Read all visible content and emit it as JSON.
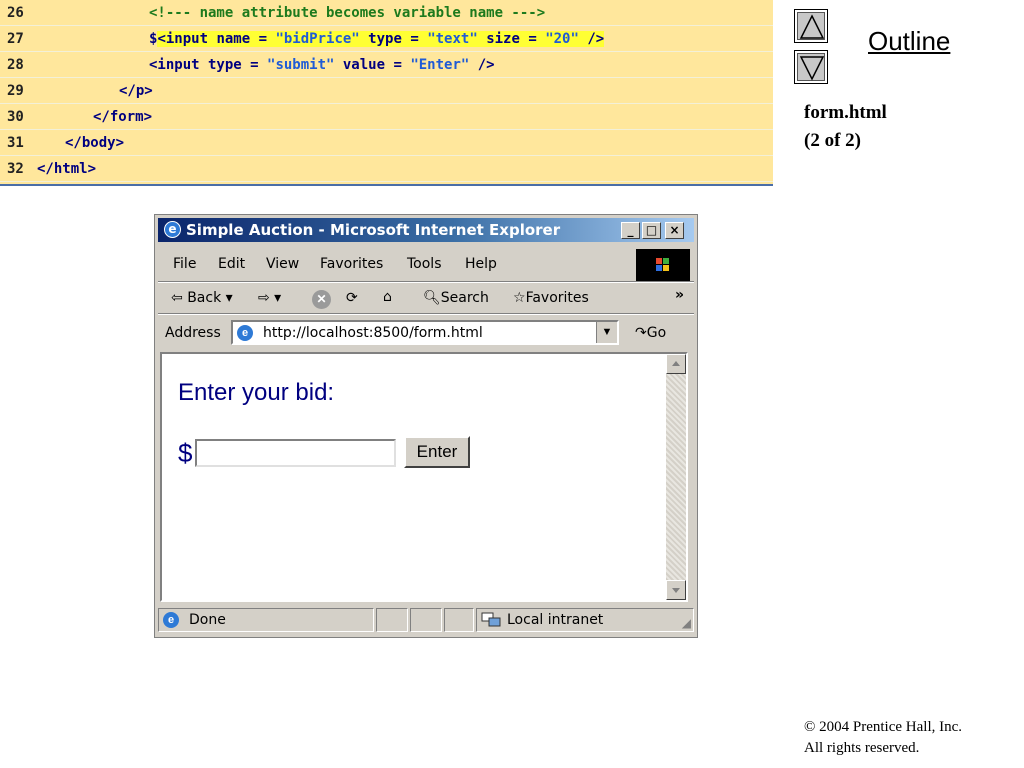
{
  "code_listing": {
    "lines": [
      {
        "num": "26",
        "segments": [
          {
            "t": "<!--- name attribute becomes variable name --->",
            "c": "c-green"
          }
        ]
      },
      {
        "num": "27",
        "segments": [
          {
            "t": "$",
            "c": "c-navy"
          },
          {
            "t": "<input name = ",
            "c": "c-navy hl"
          },
          {
            "t": "\"bidPrice\"",
            "c": "c-blue hl"
          },
          {
            "t": " type = ",
            "c": "c-navy hl"
          },
          {
            "t": "\"text\"",
            "c": "c-blue hl"
          },
          {
            "t": " size = ",
            "c": "c-navy hl"
          },
          {
            "t": "\"20\"",
            "c": "c-blue hl"
          },
          {
            "t": " />",
            "c": "c-navy hl"
          }
        ]
      },
      {
        "num": "28",
        "segments": [
          {
            "t": "<input type = ",
            "c": "c-navy"
          },
          {
            "t": "\"submit\"",
            "c": "c-blue"
          },
          {
            "t": " value = ",
            "c": "c-navy"
          },
          {
            "t": "\"Enter\"",
            "c": "c-blue"
          },
          {
            "t": " />",
            "c": "c-navy"
          }
        ]
      },
      {
        "num": "29",
        "segments": [
          {
            "t": "</p>",
            "c": "c-navy"
          }
        ]
      },
      {
        "num": "30",
        "segments": [
          {
            "t": "</form>",
            "c": "c-navy"
          }
        ]
      },
      {
        "num": "31",
        "segments": [
          {
            "t": "</body>",
            "c": "c-navy"
          }
        ]
      },
      {
        "num": "32",
        "segments": [
          {
            "t": "</html>",
            "c": "c-navy"
          }
        ]
      }
    ]
  },
  "sidebar": {
    "outline_label": "Outline",
    "file_name": "form.html",
    "page_indicator": "(2 of 2)"
  },
  "browser": {
    "title": "Simple Auction - Microsoft Internet Explorer",
    "menu": [
      "File",
      "Edit",
      "View",
      "Favorites",
      "Tools",
      "Help"
    ],
    "toolbar": {
      "back": "Back",
      "search": "Search",
      "favorites": "Favorites",
      "more": "»"
    },
    "address_label": "Address",
    "url": "http://localhost:8500/form.html",
    "go": "Go",
    "page": {
      "heading": "Enter your bid:",
      "currency": "$",
      "bid_value": "",
      "submit_label": "Enter"
    },
    "status": {
      "left": "Done",
      "zone": "Local intranet"
    }
  },
  "copyright": {
    "line1": "© 2004 Prentice Hall, Inc.",
    "line2": "All rights reserved."
  },
  "colors": {
    "code_bg": "#ffe79c",
    "highlight": "#ffff33",
    "title_bar_start": "#0a246a",
    "page_text": "#000080"
  }
}
